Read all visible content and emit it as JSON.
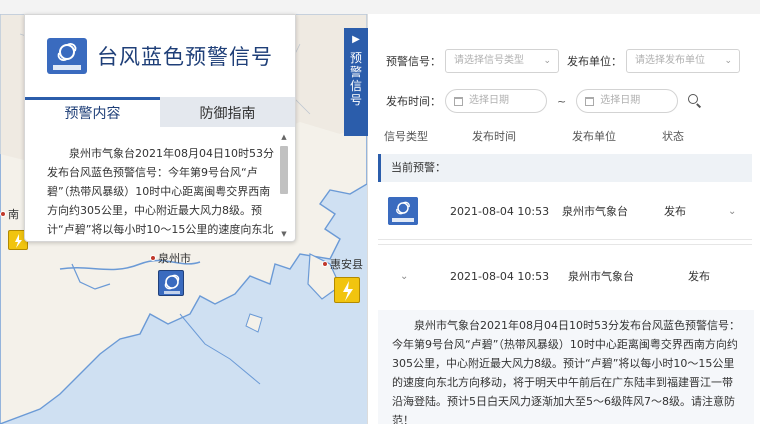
{
  "popup": {
    "title": "台风蓝色预警信号",
    "tabs": [
      "预警内容",
      "防御指南"
    ],
    "content": "泉州市气象台2021年08月04日10时53分发布台风蓝色预警信号：今年第9号台风“卢碧”（热带风暴级）10时中心距离闽粤交界西南方向约305公里，中心附近最大风力8级。预计“卢碧”将以每小时10～15公里的速度向东北方向移动"
  },
  "map": {
    "cities": [
      "泉州市",
      "惠安县",
      "南"
    ]
  },
  "side_tab": {
    "label": "预警信号",
    "arrow": "▶"
  },
  "filters": {
    "signal_label": "预警信号：",
    "signal_placeholder": "请选择信号类型",
    "unit_label": "发布单位：",
    "unit_placeholder": "请选择发布单位",
    "time_label": "发布时间：",
    "start_placeholder": "选择日期",
    "end_placeholder": "选择日期",
    "separator": "~"
  },
  "table": {
    "headers": [
      "信号类型",
      "发布时间",
      "发布单位",
      "状态"
    ],
    "current_label": "当前预警：",
    "rows": [
      {
        "time": "2021-08-04 10:53",
        "unit": "泉州市气象台",
        "status": "发布"
      },
      {
        "time": "2021-08-04 10:53",
        "unit": "泉州市气象台",
        "status": "发布"
      }
    ],
    "detail": "泉州市气象台2021年08月04日10时53分发布台风蓝色预警信号：今年第9号台风“卢碧”（热带风暴级）10时中心距离闽粤交界西南方向约305公里，中心附近最大风力8级。预计“卢碧”将以每小时10～15公里的速度向东北方向移动，将于明天中午前后在广东陆丰到福建晋江一带沿海登陆。预计5日白天风力逐渐加大至5～6级阵风7～8级。请注意防范！"
  },
  "colors": {
    "accent": "#2b5dab",
    "title": "#1f3f78",
    "blue_warning": "#3a6bbf",
    "yellow_warning": "#f1c40f"
  }
}
